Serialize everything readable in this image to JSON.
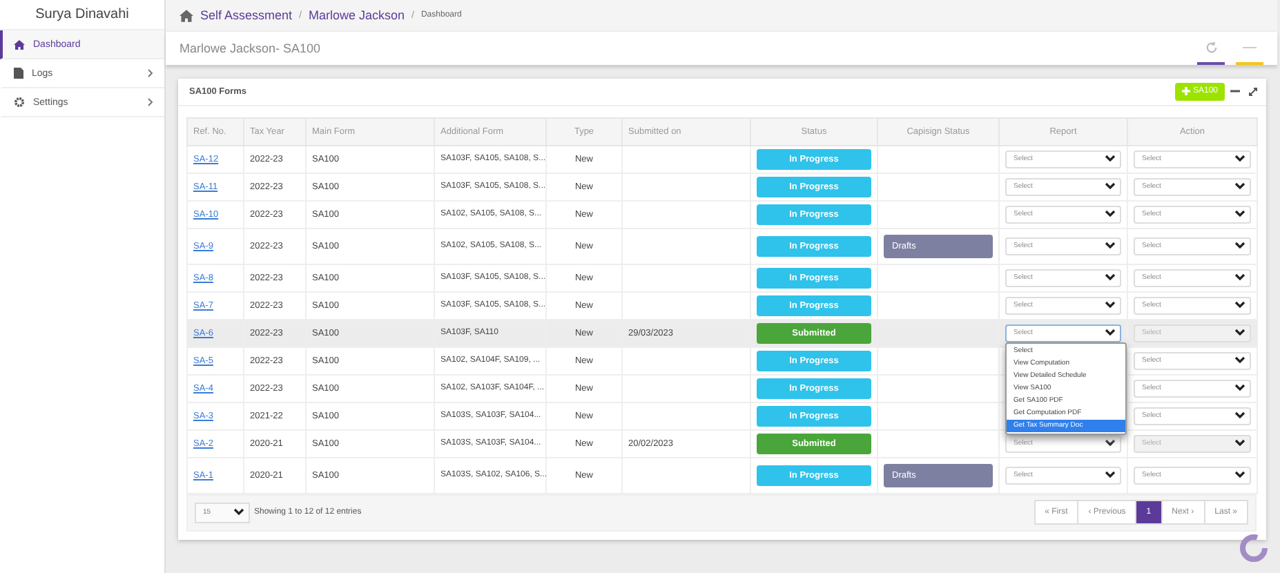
{
  "sidebar": {
    "user": "Surya Dinavahi",
    "items": [
      {
        "label": "Dashboard",
        "selected": true,
        "has_submenu": false
      },
      {
        "label": "Logs",
        "selected": false,
        "has_submenu": true
      },
      {
        "label": "Settings",
        "selected": false,
        "has_submenu": true
      }
    ]
  },
  "breadcrumb": [
    {
      "label": "Self Assessment",
      "kind": "link"
    },
    {
      "label": "/",
      "kind": "separator"
    },
    {
      "label": "Marlowe Jackson",
      "kind": "link"
    },
    {
      "label": "/",
      "kind": "separator"
    },
    {
      "label": "Dashboard",
      "kind": "current"
    }
  ],
  "page_title": "Marlowe Jackson- SA100",
  "panel": {
    "title": "SA100 Forms",
    "add_button": "SA100",
    "table": {
      "columns": [
        "Ref. No.",
        "Tax Year",
        "Main Form",
        "Additional Form",
        "Type",
        "Submitted on",
        "Status",
        "Capisign Status",
        "Report",
        "Action"
      ],
      "rows": [
        {
          "ref": "SA-12",
          "tax_year": "2022-23",
          "main_form": "SA100",
          "additional": "SA103F, SA105, SA108, S...",
          "type": "New",
          "submitted_on": "",
          "status": "In Progress",
          "kind": "progress",
          "capisign": "",
          "report": "Select",
          "action": "Select",
          "action_disabled": false,
          "hovered": false,
          "tall": false
        },
        {
          "ref": "SA-11",
          "tax_year": "2022-23",
          "main_form": "SA100",
          "additional": "SA103F, SA105, SA108, S...",
          "type": "New",
          "submitted_on": "",
          "status": "In Progress",
          "kind": "progress",
          "capisign": "",
          "report": "Select",
          "action": "Select",
          "action_disabled": false,
          "hovered": false,
          "tall": false
        },
        {
          "ref": "SA-10",
          "tax_year": "2022-23",
          "main_form": "SA100",
          "additional": "SA102, SA105, SA108, S...",
          "type": "New",
          "submitted_on": "",
          "status": "In Progress",
          "kind": "progress",
          "capisign": "",
          "report": "Select",
          "action": "Select",
          "action_disabled": false,
          "hovered": false,
          "tall": false
        },
        {
          "ref": "SA-9",
          "tax_year": "2022-23",
          "main_form": "SA100",
          "additional": "SA102, SA105, SA108, S...",
          "type": "New",
          "submitted_on": "",
          "status": "In Progress",
          "kind": "progress",
          "capisign": "Drafts",
          "report": "Select",
          "action": "Select",
          "action_disabled": false,
          "hovered": false,
          "tall": true
        },
        {
          "ref": "SA-8",
          "tax_year": "2022-23",
          "main_form": "SA100",
          "additional": "SA103F, SA105, SA108, S...",
          "type": "New",
          "submitted_on": "",
          "status": "In Progress",
          "kind": "progress",
          "capisign": "",
          "report": "Select",
          "action": "Select",
          "action_disabled": false,
          "hovered": false,
          "tall": false
        },
        {
          "ref": "SA-7",
          "tax_year": "2022-23",
          "main_form": "SA100",
          "additional": "SA103F, SA105, SA108, S...",
          "type": "New",
          "submitted_on": "",
          "status": "In Progress",
          "kind": "progress",
          "capisign": "",
          "report": "Select",
          "action": "Select",
          "action_disabled": false,
          "hovered": false,
          "tall": false
        },
        {
          "ref": "SA-6",
          "tax_year": "2022-23",
          "main_form": "SA100",
          "additional": "SA103F, SA110",
          "type": "New",
          "submitted_on": "29/03/2023",
          "status": "Submitted",
          "kind": "submitted",
          "capisign": "",
          "report": "Select",
          "report_open": true,
          "action": "Select",
          "action_disabled": true,
          "hovered": true,
          "tall": false
        },
        {
          "ref": "SA-5",
          "tax_year": "2022-23",
          "main_form": "SA100",
          "additional": "SA102, SA104F, SA109, ...",
          "type": "New",
          "submitted_on": "",
          "status": "In Progress",
          "kind": "progress",
          "capisign": "",
          "action": "Select",
          "action_disabled": false,
          "hovered": false,
          "tall": false
        },
        {
          "ref": "SA-4",
          "tax_year": "2022-23",
          "main_form": "SA100",
          "additional": "SA102, SA103F, SA104F, ...",
          "type": "New",
          "submitted_on": "",
          "status": "In Progress",
          "kind": "progress",
          "capisign": "",
          "action": "Select",
          "action_disabled": false,
          "hovered": false,
          "tall": false
        },
        {
          "ref": "SA-3",
          "tax_year": "2021-22",
          "main_form": "SA100",
          "additional": "SA103S, SA103F, SA104...",
          "type": "New",
          "submitted_on": "",
          "status": "In Progress",
          "kind": "progress",
          "capisign": "",
          "action": "Select",
          "action_disabled": false,
          "hovered": false,
          "tall": false
        },
        {
          "ref": "SA-2",
          "tax_year": "2020-21",
          "main_form": "SA100",
          "additional": "SA103S, SA103F, SA104...",
          "type": "New",
          "submitted_on": "20/02/2023",
          "status": "Submitted",
          "kind": "submitted",
          "capisign": "",
          "report": "Select",
          "action": "Select",
          "action_disabled": true,
          "hovered": false,
          "tall": false
        },
        {
          "ref": "SA-1",
          "tax_year": "2020-21",
          "main_form": "SA100",
          "additional": "SA103S, SA102, SA106, S...",
          "type": "New",
          "submitted_on": "",
          "status": "In Progress",
          "kind": "progress",
          "capisign": "Drafts",
          "report": "Select",
          "action": "Select",
          "action_disabled": false,
          "hovered": false,
          "tall": true
        }
      ]
    },
    "report_options": [
      {
        "label": "Select",
        "selected": false
      },
      {
        "label": "View Computation",
        "selected": false
      },
      {
        "label": "View Detailed Schedule",
        "selected": false
      },
      {
        "label": "View SA100",
        "selected": false
      },
      {
        "label": "Get SA100 PDF",
        "selected": false
      },
      {
        "label": "Get Computation PDF",
        "selected": false
      },
      {
        "label": "Get Tax Summary Doc",
        "selected": true
      }
    ],
    "page_size": "15",
    "entries_info": "Showing 1 to 12 of 12 entries",
    "pagination": [
      {
        "label": "« First",
        "selected": false
      },
      {
        "label": "‹ Previous",
        "selected": false
      },
      {
        "label": "1",
        "selected": true
      },
      {
        "label": "Next ›",
        "selected": false
      },
      {
        "label": "Last »",
        "selected": false
      }
    ]
  }
}
